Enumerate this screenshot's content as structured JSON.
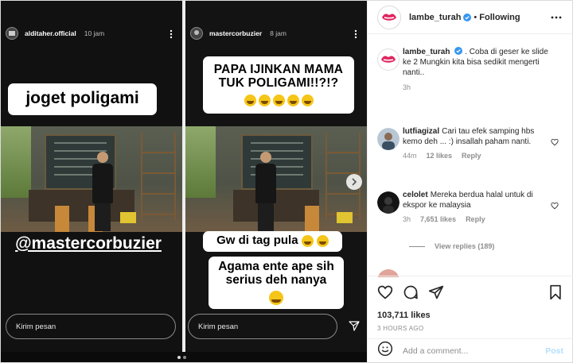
{
  "story1": {
    "username": "alditaher.official",
    "time": "10 jam",
    "text_top": "joget poligami",
    "text_bottom": "@mastercorbuzier",
    "message_placeholder": "Kirim pesan"
  },
  "story2": {
    "username": "mastercorbuzier",
    "time": "8 jam",
    "text_top": "PAPA IJINKAN MAMA TUK POLIGAMI!!?!?",
    "text_mid": "Gw di tag pula",
    "text_bottom": "Agama ente ape sih serius deh nanya",
    "message_placeholder": "Kirim pesan"
  },
  "post": {
    "username": "lambe_turah",
    "follow_status": "Following",
    "likes": "103,711 likes",
    "time_ago": "3 HOURS AGO",
    "add_comment_placeholder": "Add a comment...",
    "post_label": "Post"
  },
  "comments": [
    {
      "username": "lambe_turah",
      "text": ". Coba di geser ke slide ke 2 Mungkin kita bisa sedikit mengerti nanti..",
      "time": "3h"
    },
    {
      "username": "lutfiagizal",
      "text": "Cari tau efek samping hbs kemo deh ... :) insallah paham nanti.",
      "time": "44m",
      "likes": "12 likes",
      "reply": "Reply"
    },
    {
      "username": "celolet",
      "text": "Mereka berdua halal untuk di ekspor ke malaysia",
      "time": "3h",
      "likes": "7,651 likes",
      "reply": "Reply",
      "view_replies": "View replies (189)"
    }
  ],
  "colors": {
    "link_blue": "#3897f0",
    "post_disabled": "#b2dffc",
    "lambe_red": "#e0245e"
  }
}
